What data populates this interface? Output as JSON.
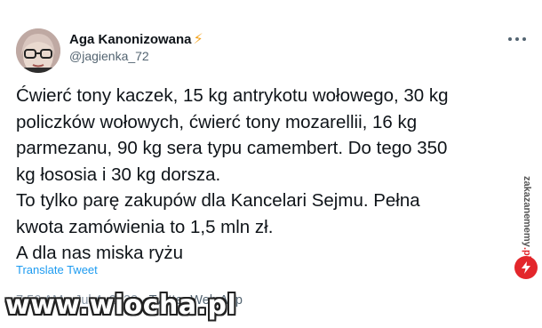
{
  "tweet": {
    "author_name": "Aga Kanonizowana",
    "author_handle": "@jagienka_72",
    "lines": [
      "Ćwierć tony kaczek, 15 kg antrykotu wołowego, 30 kg",
      "policzków wołowych, ćwierć tony mozarellii, 16 kg",
      "parmezanu, 90 kg sera typu camembert. Do tego 350",
      "kg łososia i 30 kg dorsza.",
      "To tylko parę zakupów dla Kancelari Sejmu. Pełna",
      "kwota zamówienia to 1,5 mln zł.",
      "A dla nas miska ryżu"
    ],
    "translate_label": "Translate Tweet",
    "meta_partial": "7:56 AM · Jul 4, 2022",
    "meta_source": " · Twitter Web App"
  },
  "watermark": {
    "site": "www.wiocha.pl"
  },
  "side_logo": {
    "line1": "zakazane",
    "line2": "memy",
    "line3": ".pl"
  },
  "colors": {
    "link_blue": "#1d9bf0",
    "secondary_text": "#536471",
    "verified_bolt": "#f5a623",
    "logo_red": "#e3262b"
  },
  "icons": {
    "more": "more-horizontal-icon",
    "bolt": "lightning-bolt-icon",
    "logo_badge": "lightning-badge-icon"
  }
}
